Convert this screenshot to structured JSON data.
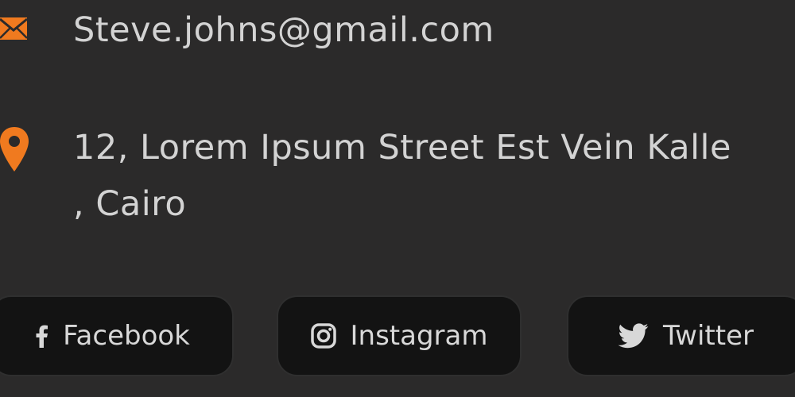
{
  "contact": {
    "email": "Steve.johns@gmail.com",
    "address_line1": "12, Lorem Ipsum Street Est Vein Kalle",
    "address_line2": ", Cairo",
    "email_icon": "envelope-icon",
    "address_icon": "location-pin-icon"
  },
  "social": [
    {
      "label": "Facebook",
      "icon": "facebook-icon"
    },
    {
      "label": "Instagram",
      "icon": "instagram-icon"
    },
    {
      "label": "Twitter",
      "icon": "twitter-icon"
    }
  ],
  "colors": {
    "background": "#2b2a2a",
    "accent": "#f07a1f",
    "text": "#d3d3d3",
    "button_background": "#131313"
  }
}
